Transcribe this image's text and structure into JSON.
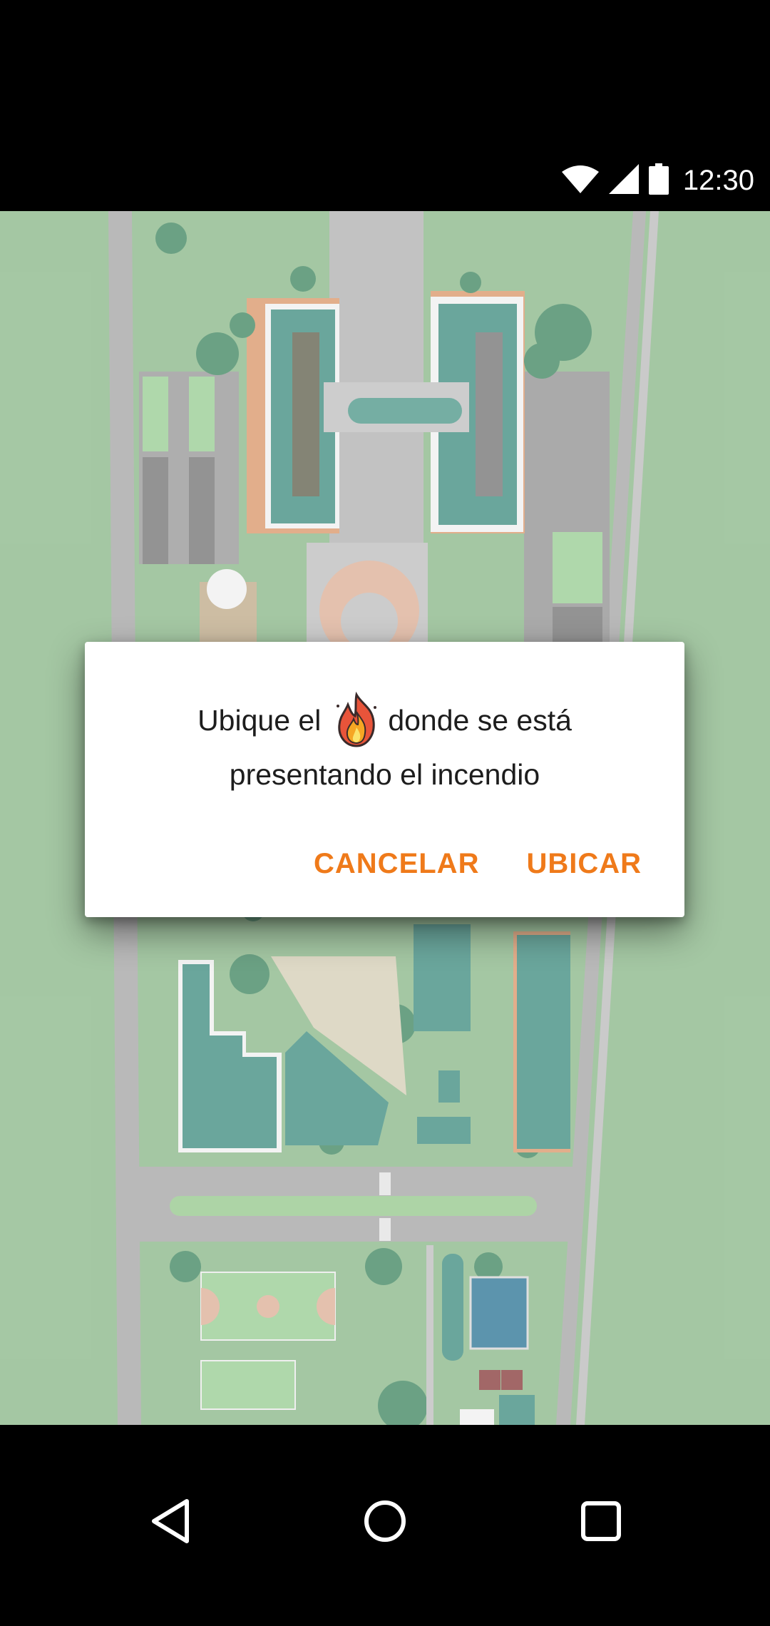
{
  "status_bar": {
    "time": "12:30",
    "icons": [
      "wifi-icon",
      "cell-signal-icon",
      "battery-icon"
    ]
  },
  "map": {
    "description_icons": [
      "campus-map"
    ],
    "colors": {
      "grass": "#9dc39c",
      "road": "#b6b6b6",
      "roof": "#5e9f94"
    }
  },
  "dialog": {
    "message_before_icon": "Ubique el",
    "message_after_icon": "donde se está presentando el incendio",
    "icon": "fire-icon",
    "cancel_label": "CANCELAR",
    "confirm_label": "UBICAR",
    "accent_color": "#ef7a1a"
  },
  "nav_bar": {
    "icons": [
      "back-icon",
      "home-icon",
      "recents-icon"
    ]
  }
}
